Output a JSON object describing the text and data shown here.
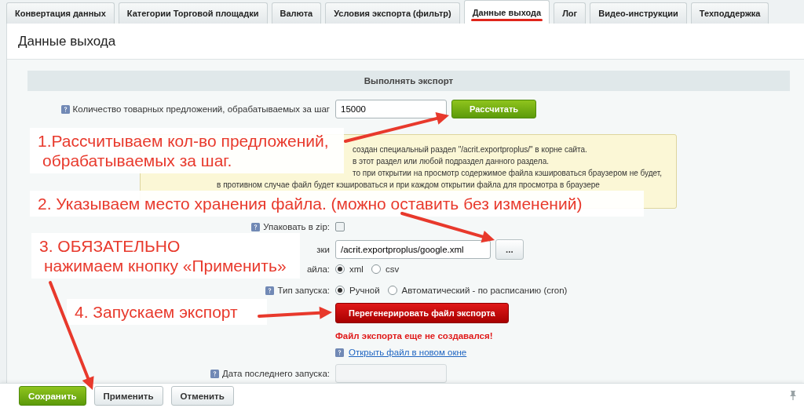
{
  "tabs": [
    {
      "label": "Конвертация данных",
      "selected": false
    },
    {
      "label": "Категории Торговой площадки",
      "selected": false
    },
    {
      "label": "Валюта",
      "selected": false
    },
    {
      "label": "Условия экспорта (фильтр)",
      "selected": false
    },
    {
      "label": "Данные выхода",
      "selected": true
    },
    {
      "label": "Лог",
      "selected": false
    },
    {
      "label": "Видео-инструкции",
      "selected": false
    },
    {
      "label": "Техподдержка",
      "selected": false
    }
  ],
  "page_title": "Данные выхода",
  "section_header": "Выполнять экспорт",
  "step_field": {
    "label": "Количество товарных предложений, обрабатываемых за шаг",
    "value": "15000",
    "button": "Рассчитать"
  },
  "note_lines": [
    {
      "kind": "partial",
      "text": "создан специальный раздел \"/acrit.exportproplus/\" в корне сайта."
    },
    {
      "kind": "partial",
      "text": "в этот раздел или любой подраздел данного раздела."
    },
    {
      "kind": "partial",
      "text": "то при открытии на просмотр содержимое файла кэшироваться браузером не будет,"
    },
    {
      "kind": "full",
      "text": "в противном случае файл будет кэшироваться и при каждом открытии файла для просмотра в браузере"
    }
  ],
  "zip": {
    "label": "Упаковать в zip:",
    "checked": false
  },
  "file": {
    "label": "зки",
    "value": "/acrit.exportproplus/google.xml",
    "browse_button": "..."
  },
  "file_type": {
    "label": "айла:",
    "options": [
      {
        "label": "xml",
        "selected": true
      },
      {
        "label": "csv",
        "selected": false
      }
    ]
  },
  "launch_type": {
    "label": "Тип запуска:",
    "options": [
      {
        "label": "Ручной",
        "selected": true
      },
      {
        "label": "Автоматический - по расписанию (cron)",
        "selected": false
      }
    ]
  },
  "regenerate_button": "Перегенерировать файл экспорта",
  "status_message": "Файл экспорта еще не создавался!",
  "open_link": "Открыть файл в новом окне",
  "last_run": {
    "label": "Дата последнего запуска:"
  },
  "footer_buttons": [
    {
      "label": "Сохранить",
      "kind": "primary"
    },
    {
      "label": "Применить",
      "kind": "secondary"
    },
    {
      "label": "Отменить",
      "kind": "secondary"
    }
  ],
  "callouts": [
    {
      "lines": [
        "1.Рассчитываем кол-во предложений,",
        "обрабатываемых за шаг."
      ]
    },
    {
      "lines": [
        "2. Указываем место хранения файла. (можно оставить без изменений)"
      ]
    },
    {
      "lines": [
        "3. ОБЯЗАТЕЛЬНО",
        "нажимаем кнопку «Применить»"
      ]
    },
    {
      "lines": [
        "4. Запускаем экспорт"
      ]
    }
  ]
}
